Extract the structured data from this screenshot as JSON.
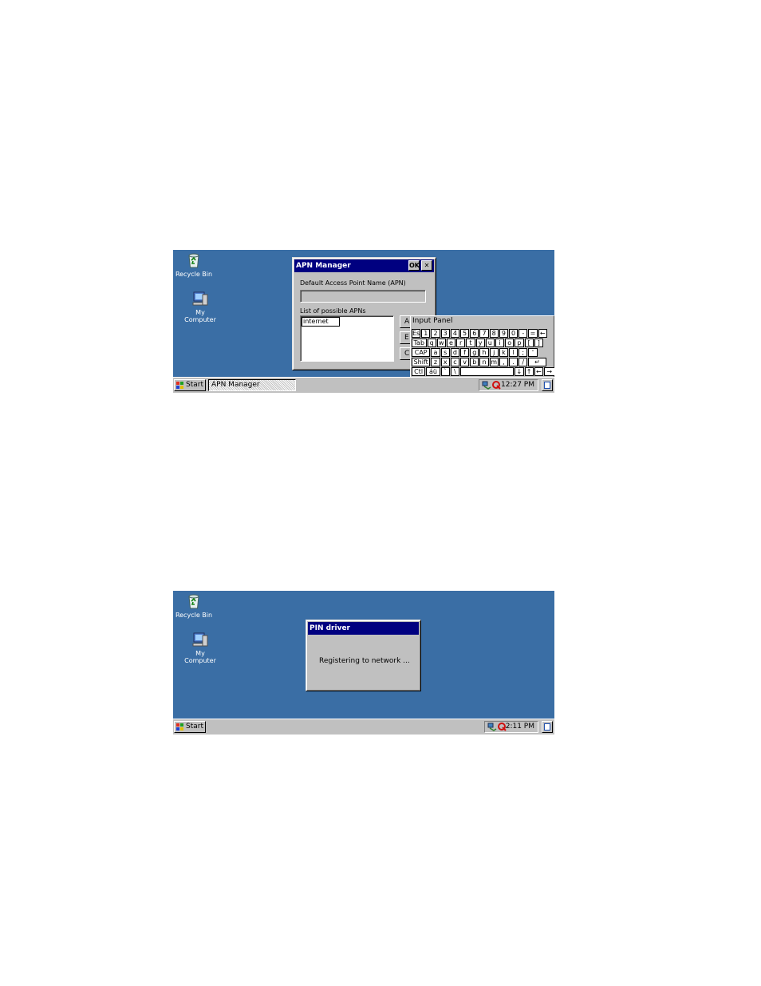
{
  "screens": [
    {
      "desktop": {
        "recycle_bin": "Recycle Bin",
        "my_computer_line1": "My",
        "my_computer_line2": "Computer"
      },
      "apn_dialog": {
        "title": "APN Manager",
        "ok_label": "OK",
        "close_label": "✕",
        "default_apn_label": "Default Access Point Name (APN)",
        "default_apn_value": "",
        "list_label": "List of possible APNs",
        "list_items": [
          "internet"
        ],
        "side_buttons": [
          "A",
          "E",
          "C"
        ]
      },
      "input_panel": {
        "title": "Input Panel",
        "rows": [
          [
            "Esc",
            "1",
            "2",
            "3",
            "4",
            "5",
            "6",
            "7",
            "8",
            "9",
            "0",
            "-",
            "=",
            "←"
          ],
          [
            "Tab",
            "q",
            "w",
            "e",
            "r",
            "t",
            "y",
            "u",
            "i",
            "o",
            "p",
            "[",
            "]"
          ],
          [
            "CAP",
            "a",
            "s",
            "d",
            "f",
            "g",
            "h",
            "j",
            "k",
            "l",
            ";",
            "'"
          ],
          [
            "Shift",
            "z",
            "x",
            "c",
            "v",
            "b",
            "n",
            "m",
            ",",
            ".",
            "/",
            "↵"
          ],
          [
            "Ctl",
            "áü",
            "`",
            "\\",
            "",
            "↓",
            "↑",
            "←",
            "→"
          ]
        ]
      },
      "taskbar": {
        "start_label": "Start",
        "task_label": "APN Manager",
        "clock": "12:27 PM"
      }
    },
    {
      "desktop": {
        "recycle_bin": "Recycle Bin",
        "my_computer_line1": "My",
        "my_computer_line2": "Computer"
      },
      "pin_dialog": {
        "title": "PIN driver",
        "message": "Registering to network ..."
      },
      "taskbar": {
        "start_label": "Start",
        "clock": "2:11 PM"
      }
    }
  ],
  "colors": {
    "desktop": "#3a6ea5",
    "titlebar": "#000080",
    "chrome": "#c0c0c0"
  },
  "icons": [
    "recycle-bin-icon",
    "my-computer-icon",
    "windows-flag-icon",
    "network-icon",
    "signal-icon",
    "keyboard-icon"
  ]
}
